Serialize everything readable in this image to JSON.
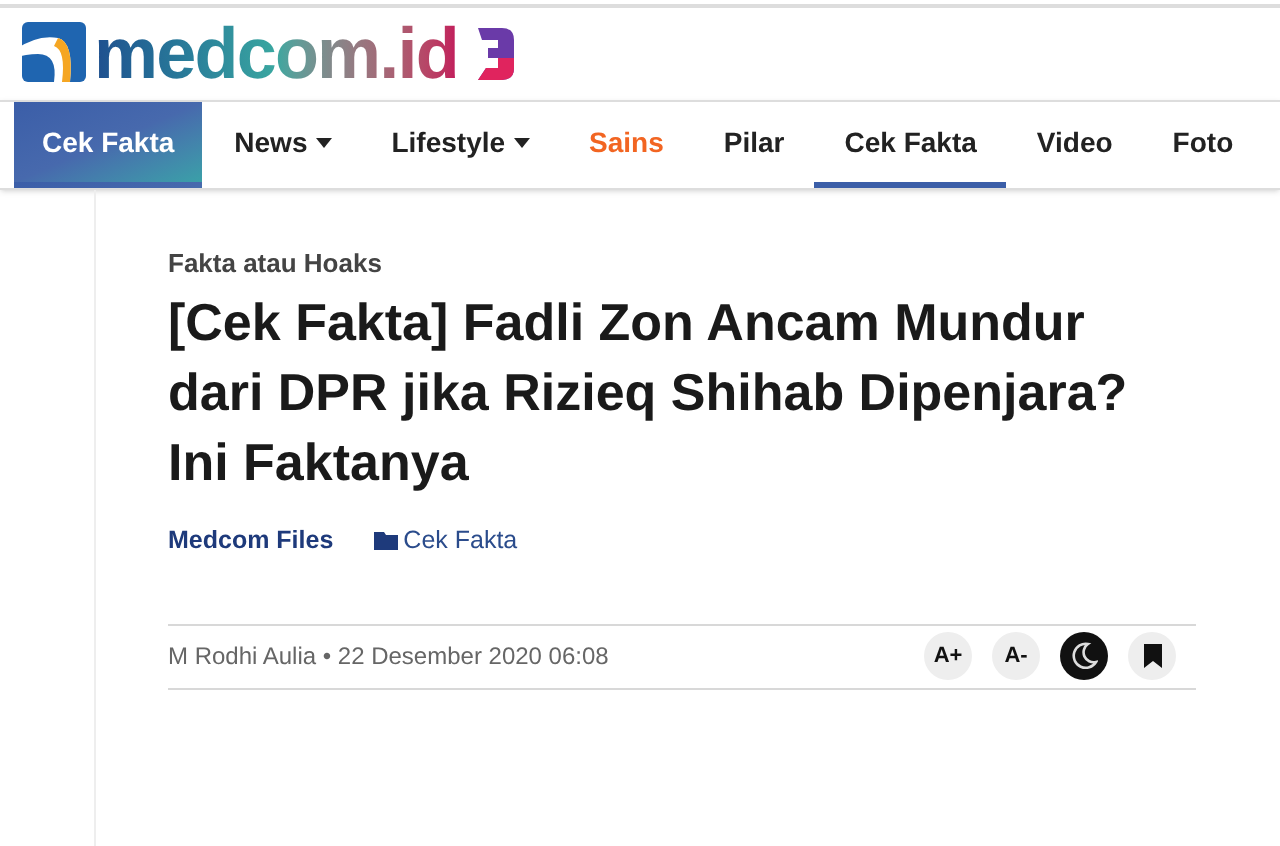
{
  "logo": {
    "text": "medcom.id"
  },
  "nav": [
    {
      "label": "Cek Fakta",
      "kind": "block",
      "dropdown": false,
      "selected": false,
      "accent": false
    },
    {
      "label": "News",
      "kind": "link",
      "dropdown": true,
      "selected": false,
      "accent": false
    },
    {
      "label": "Lifestyle",
      "kind": "link",
      "dropdown": true,
      "selected": false,
      "accent": false
    },
    {
      "label": "Sains",
      "kind": "link",
      "dropdown": false,
      "selected": false,
      "accent": true
    },
    {
      "label": "Pilar",
      "kind": "link",
      "dropdown": false,
      "selected": false,
      "accent": false
    },
    {
      "label": "Cek Fakta",
      "kind": "link",
      "dropdown": false,
      "selected": true,
      "accent": false
    },
    {
      "label": "Video",
      "kind": "link",
      "dropdown": false,
      "selected": false,
      "accent": false
    },
    {
      "label": "Foto",
      "kind": "link",
      "dropdown": false,
      "selected": false,
      "accent": false
    }
  ],
  "article": {
    "category": "Fakta atau Hoaks",
    "title": "[Cek Fakta] Fadli Zon Ancam Mundur dari DPR jika Rizieq Shihab Dipenjara? Ini Faktanya",
    "source": "Medcom Files",
    "channel": "Cek Fakta",
    "byline": "M Rodhi Aulia • 22 Desember 2020 06:08",
    "tools": [
      {
        "kind": "font-up",
        "label": "A+",
        "on": false
      },
      {
        "kind": "font-down",
        "label": "A-",
        "on": false
      },
      {
        "kind": "dark-mode",
        "on": true
      },
      {
        "kind": "bookmark",
        "on": false
      }
    ]
  }
}
